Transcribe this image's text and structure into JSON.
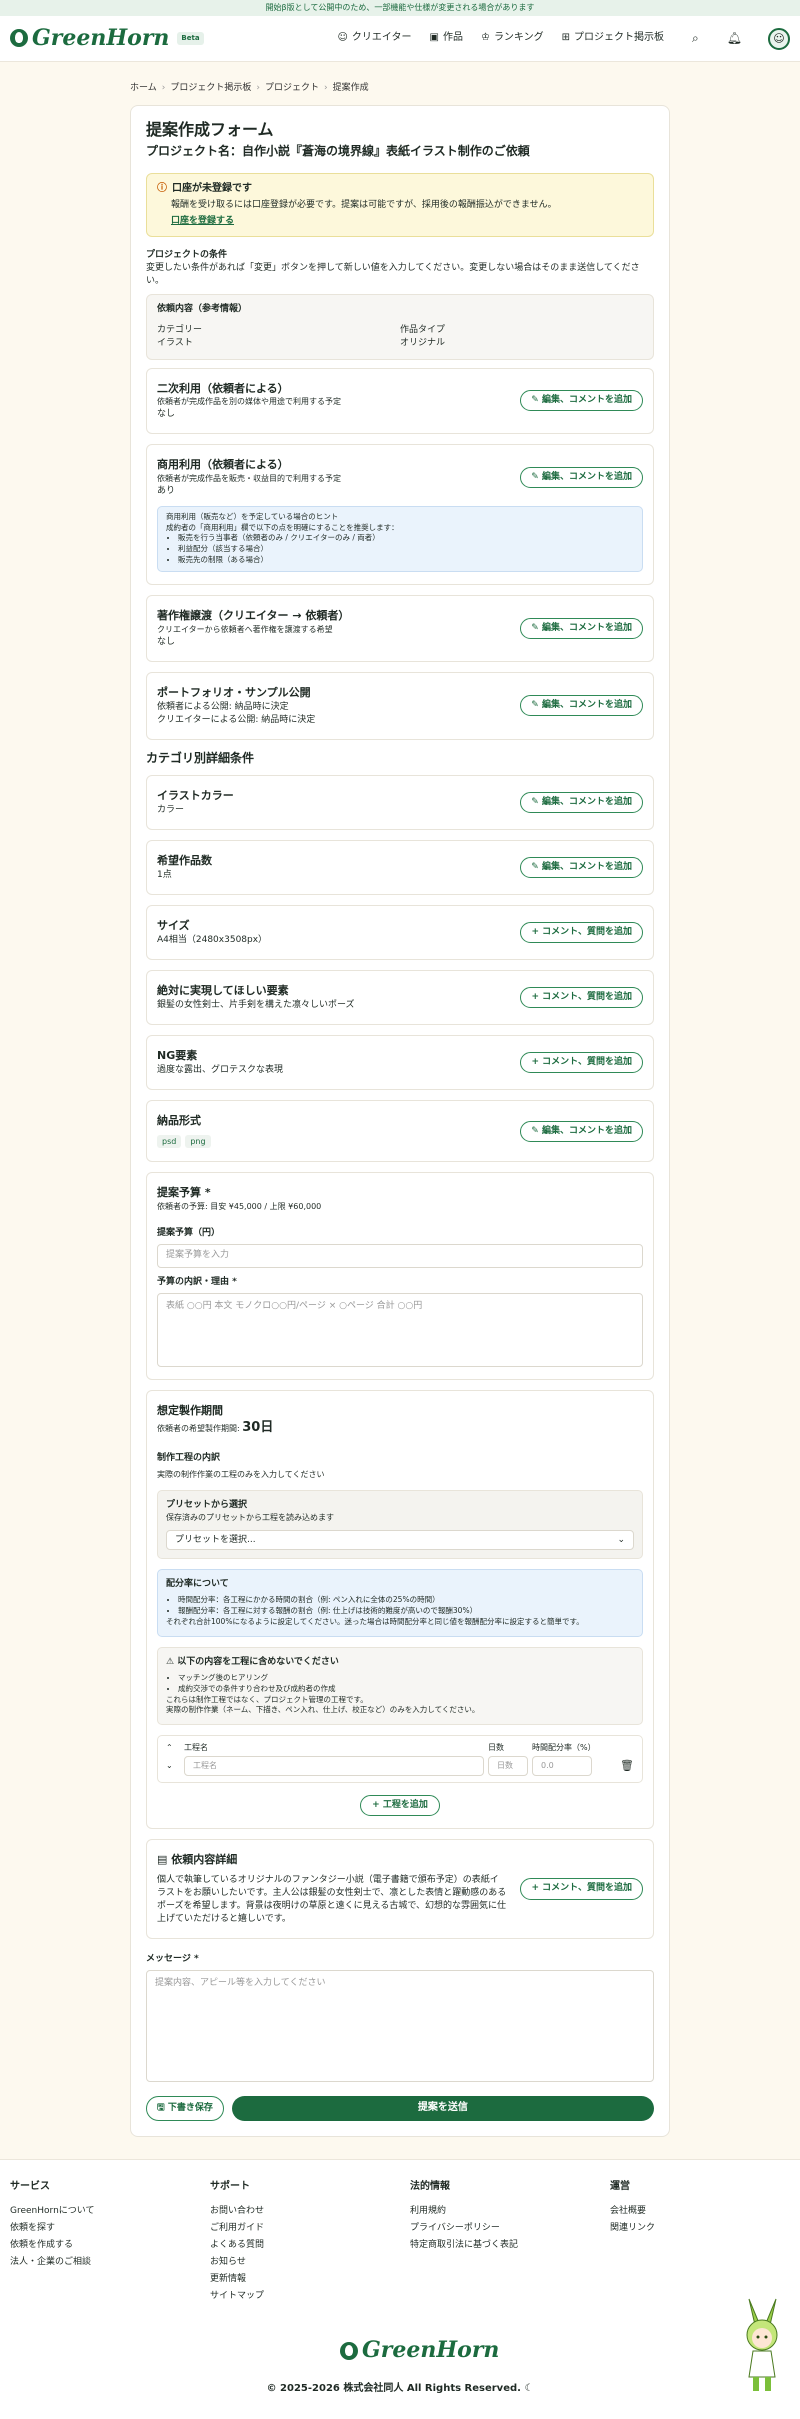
{
  "banner": "開始β版として公開中のため、一部機能や仕様が変更される場合があります",
  "header": {
    "logo": "GreenHorn",
    "beta": "Beta",
    "nav": [
      "クリエイター",
      "作品",
      "ランキング",
      "プロジェクト掲示板"
    ]
  },
  "breadcrumb": [
    "ホーム",
    "プロジェクト掲示板",
    "プロジェクト",
    "提案作成"
  ],
  "form": {
    "title": "提案作成フォーム",
    "project_name": "プロジェクト名：自作小説『蒼海の境界線』表紙イラスト制作のご依頼",
    "alert": {
      "title": "口座が未登録です",
      "body": "報酬を受け取るには口座登録が必要です。提案は可能ですが、採用後の報酬振込ができません。",
      "link": "口座を登録する"
    },
    "conditions_title": "プロジェクトの条件",
    "conditions_desc": "変更したい条件があれば「変更」ボタンを押して新しい値を入力してください。変更しない場合はそのまま送信してください。",
    "ref": {
      "title": "依頼内容（参考情報）",
      "category_label": "カテゴリー",
      "category_value": "イラスト",
      "type_label": "作品タイプ",
      "type_value": "オリジナル"
    },
    "conditions": [
      {
        "title": "二次利用（依頼者による）",
        "sub": "依頼者が完成作品を別の媒体や用途で利用する予定",
        "value": "なし",
        "button": "編集、コメントを追加"
      },
      {
        "title": "商用利用（依頼者による）",
        "sub": "依頼者が完成作品を販売・収益目的で利用する予定",
        "value": "あり",
        "button": "編集、コメントを追加"
      },
      {
        "title": "著作権譲渡（クリエイター → 依頼者）",
        "sub": "クリエイターから依頼者へ著作権を譲渡する希望",
        "value": "なし",
        "button": "編集、コメントを追加"
      },
      {
        "title": "ポートフォリオ・サンプル公開",
        "sub": "依頼者による公開: 納品時に決定",
        "value": "クリエイターによる公開: 納品時に決定",
        "button": "編集、コメントを追加"
      }
    ],
    "hint": {
      "line1": "商用利用（販売など）を予定している場合のヒント",
      "line2": "成約者の「商用利用」欄で以下の点を明確にすることを推奨します：",
      "items": [
        "販売を行う当事者（依頼者のみ / クリエイターのみ / 両者）",
        "利益配分（該当する場合）",
        "販売先の制限（ある場合）"
      ]
    },
    "category_section": "カテゴリ別詳細条件",
    "details": [
      {
        "title": "イラストカラー",
        "value": "カラー",
        "button": "編集、コメントを追加"
      },
      {
        "title": "希望作品数",
        "value": "1点",
        "button": "編集、コメントを追加"
      },
      {
        "title": "サイズ",
        "value": "A4相当（2480x3508px）",
        "button": "コメント、質問を追加"
      },
      {
        "title": "絶対に実現してほしい要素",
        "value": "銀髪の女性剣士、片手剣を構えた凛々しいポーズ",
        "button": "コメント、質問を追加"
      },
      {
        "title": "NG要素",
        "value": "過度な露出、グロテスクな表現",
        "button": "コメント、質問を追加"
      }
    ],
    "delivery": {
      "title": "納品形式",
      "tags": [
        "psd",
        "png"
      ],
      "button": "編集、コメントを追加"
    },
    "budget": {
      "title": "提案予算 *",
      "client_budget": "依頼者の予算: 目安 ¥45,000 / 上限 ¥60,000",
      "label": "提案予算（円）",
      "placeholder": "提案予算を入力",
      "breakdown_label": "予算の内訳・理由 *",
      "breakdown_placeholder": "表紙 ○○円 本文 モノクロ○○円/ページ × ○ページ 合計 ○○円"
    },
    "period": {
      "title": "想定製作期間",
      "client_label": "依頼者の希望製作期間:",
      "client_value": "30日",
      "process_label": "制作工程の内訳",
      "process_desc": "実際の制作作業の工程のみを入力してください",
      "preset_title": "プリセットから選択",
      "preset_desc": "保存済みのプリセットから工程を読み込めます",
      "preset_select": "プリセットを選択...",
      "ratio_title": "配分率について",
      "ratio_items": [
        "時間配分率：各工程にかかる時間の割合（例: ペン入れに全体の25%の時間）",
        "報酬配分率：各工程に対する報酬の割合（例: 仕上げは技術的難度が高いので報酬30%）"
      ],
      "ratio_note": "それぞれ合計100%になるように設定してください。迷った場合は時間配分率と同じ値を報酬配分率に設定すると簡単です。",
      "exclude_title": "⚠ 以下の内容を工程に含めないでください",
      "exclude_items": [
        "マッチング後のヒアリング",
        "成約交渉での条件すり合わせ及び成約者の作成"
      ],
      "exclude_note1": "これらは制作工程ではなく、プロジェクト管理の工程です。",
      "exclude_note2": "実際の制作作業（ネーム、下描き、ペン入れ、仕上げ、校正など）のみを入力してください。",
      "col_name": "工程名",
      "col_days": "日数",
      "col_ratio": "時間配分率（%）",
      "ph_name": "工程名",
      "ph_days": "日数",
      "ph_ratio": "0.0",
      "add_step": "工程を追加"
    },
    "request_detail": {
      "title": "依頼内容詳細",
      "body": "個人で執筆しているオリジナルのファンタジー小説（電子書籍で頒布予定）の表紙イラストをお願いしたいです。主人公は銀髪の女性剣士で、凛とした表情と躍動感のあるポーズを希望します。背景は夜明けの草原と遠くに見える古城で、幻想的な雰囲気に仕上げていただけると嬉しいです。",
      "button": "コメント、質問を追加"
    },
    "message": {
      "label": "メッセージ *",
      "placeholder": "提案内容、アピール等を入力してください"
    },
    "draft": "下書き保存",
    "submit": "提案を送信"
  },
  "footer": {
    "cols": [
      {
        "title": "サービス",
        "links": [
          "GreenHornについて",
          "依頼を探す",
          "依頼を作成する",
          "法人・企業のご相談"
        ]
      },
      {
        "title": "サポート",
        "links": [
          "お問い合わせ",
          "ご利用ガイド",
          "よくある質問",
          "お知らせ",
          "更新情報",
          "サイトマップ"
        ]
      },
      {
        "title": "法的情報",
        "links": [
          "利用規約",
          "プライバシーポリシー",
          "特定商取引法に基づく表記"
        ]
      },
      {
        "title": "運営",
        "links": [
          "会社概要",
          "関連リンク"
        ]
      }
    ],
    "logo": "GreenHorn",
    "copyright": "© 2025-2026 株式会社同人 All Rights Reserved."
  },
  "colors": {
    "brand": "#1c6b3f",
    "background": "#fdf9ef",
    "alert": "#fdf8db",
    "info": "#eaf3fc"
  }
}
